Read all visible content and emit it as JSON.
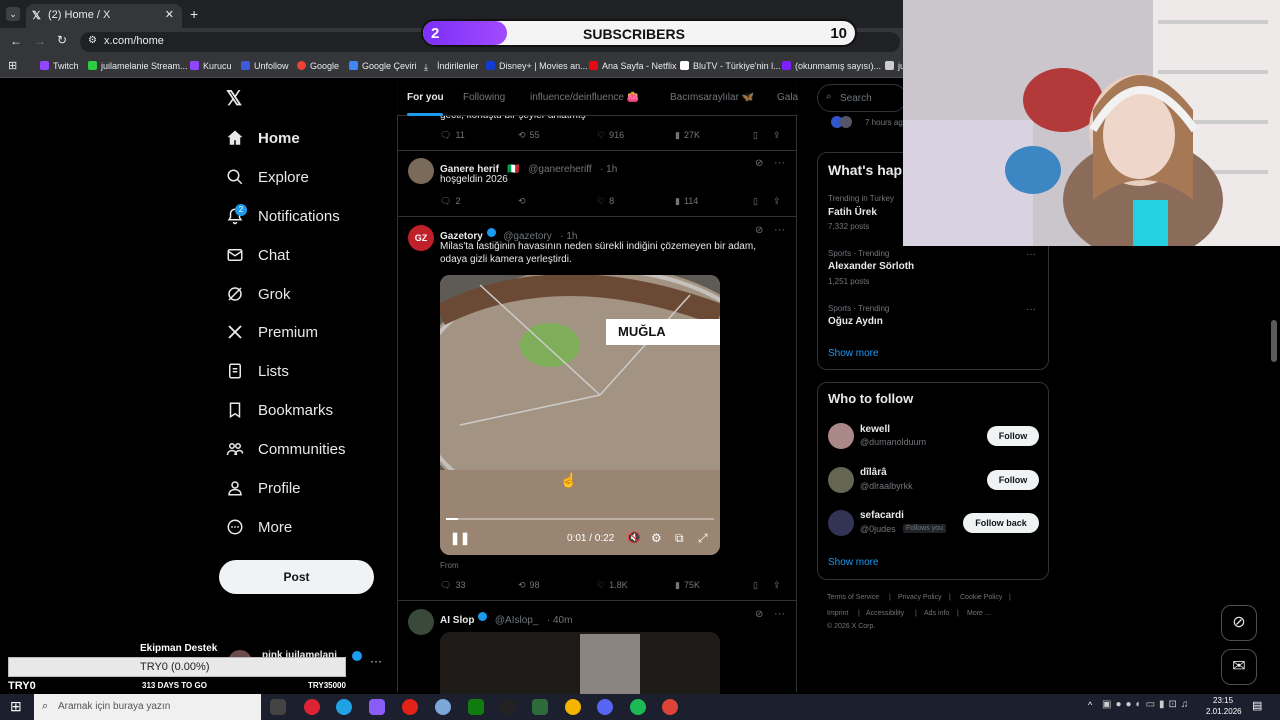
{
  "browser": {
    "tab_title": "(2) Home / X",
    "url": "x.com/home",
    "bookmarks": [
      "Twitch",
      "juilamelanie Stream...",
      "Kurucu",
      "Unfollow",
      "Google",
      "Google Çeviri",
      "İndirilenler",
      "Disney+ | Movies an...",
      "Ana Sayfa - Netflix",
      "BluTV - Türkiye'nin l...",
      "(okunmamış sayısı)...",
      "ju"
    ]
  },
  "subs_overlay": {
    "left": "2",
    "label": "SUBSCRIBERS",
    "right": "10"
  },
  "sidebar": {
    "items": [
      "Home",
      "Explore",
      "Notifications",
      "Chat",
      "Grok",
      "Premium",
      "Lists",
      "Bookmarks",
      "Communities",
      "Profile",
      "More"
    ],
    "notif_badge": "2",
    "post_label": "Post",
    "account_name": "pink juilamelani"
  },
  "feed": {
    "tabs": [
      "For you",
      "Following",
      "influence/deinfluence 👛",
      "Bacımsaraylılar 🦋",
      "Gala"
    ],
    "partial_text": "gecti, konuştu bir şeyler anlatmış",
    "t0_stats": {
      "replies": "11",
      "reposts": "55",
      "likes": "916",
      "views": "27K"
    },
    "t1": {
      "name": "Ganere herif",
      "flag": "🇮🇹",
      "handle": "@ganereheriff",
      "time": "· 1h",
      "text": "hoşgeldin 2026",
      "replies": "2",
      "reposts": "",
      "likes": "8",
      "views": "114"
    },
    "t2": {
      "name": "Gazetory",
      "handle": "@gazetory",
      "time": "· 1h",
      "text": "Milas'ta lastiğinin havasının neden sürekli indiğini çözemeyen bir adam, odaya gizli kamera yerleştirdi.",
      "video_label": "MUĞLA",
      "video_time": "0:01 / 0:22",
      "progress": 0.045,
      "from": "From ",
      "replies": "33",
      "reposts": "98",
      "likes": "1.8K",
      "views": "75K",
      "avatar": "GZ"
    },
    "t3": {
      "name": "AI Slop",
      "handle": "@AIslop_",
      "time": "· 40m"
    }
  },
  "right": {
    "search_placeholder": "Search",
    "time_ago": "7 hours ago",
    "whats_happening": "What's hap",
    "trends": [
      {
        "meta": "Trending in Turkey",
        "name": "Fatih Ürek",
        "posts": "7,332 posts"
      },
      {
        "meta": "Sports · Trending",
        "name": "Alexander Sörloth",
        "posts": "1,251 posts"
      },
      {
        "meta": "Sports · Trending",
        "name": "Oğuz Aydın",
        "posts": ""
      }
    ],
    "show_more": "Show more",
    "who_to_follow": "Who to follow",
    "suggestions": [
      {
        "name": "kewell",
        "handle": "@dumanolduum",
        "button": "Follow",
        "note": ""
      },
      {
        "name": "dîlârâ",
        "handle": "@dlraalbyrkk",
        "button": "Follow",
        "note": ""
      },
      {
        "name": "sefacardi",
        "handle": "@0judes",
        "button": "Follow back",
        "note": "Follows you"
      }
    ],
    "footer": [
      "Terms of Service",
      "|",
      "Privacy Policy",
      "|",
      "Cookie Policy",
      "|",
      "Imprint",
      "|",
      "Accessibility",
      "|",
      "Ads info",
      "|",
      "More ...",
      "© 2026 X Corp."
    ]
  },
  "stream_overlay": {
    "title": "Ekipman Destek",
    "goal": "TRY0 (0.00%)",
    "left": "TRY0",
    "days": "313 DAYS TO GO",
    "right": "TRY35000"
  },
  "taskbar": {
    "search": "Aramak için buraya yazın",
    "time": "23:15",
    "date": "2.01.2026"
  },
  "colors": {
    "accent": "#1d9bf0",
    "purple": "#8a2be2"
  }
}
